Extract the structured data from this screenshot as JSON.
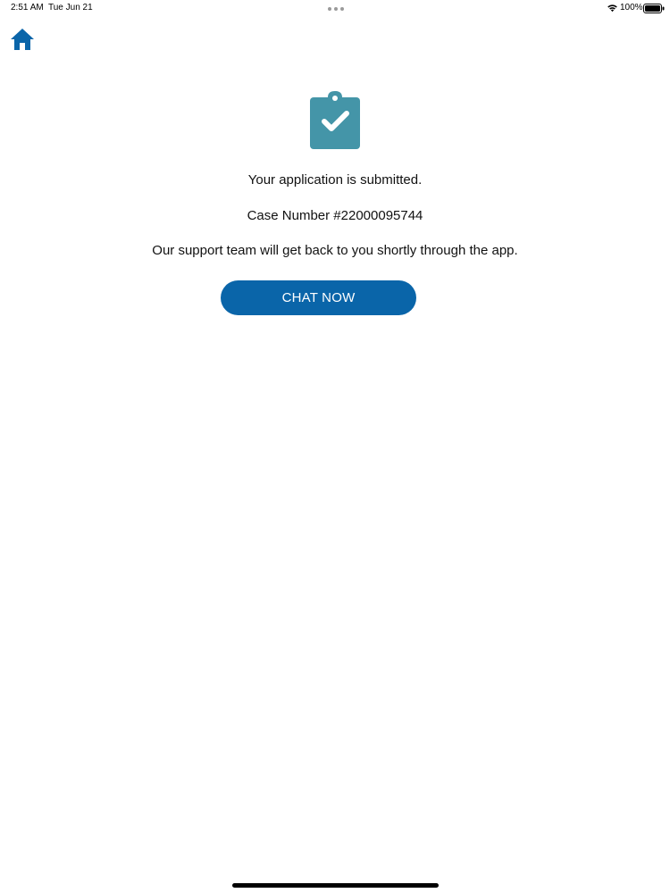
{
  "status_bar": {
    "time": "2:51 AM",
    "date": "Tue Jun 21",
    "battery": "100%",
    "icons": [
      "wifi-icon",
      "battery-icon"
    ]
  },
  "header": {
    "home_icon": "home-icon"
  },
  "confirmation": {
    "icon": "clipboard-check-icon",
    "message": "Your application is submitted.",
    "case_number": "Case Number #22000095744",
    "support_message": "Our support team will get back to you shortly through the app.",
    "chat_button_label": "CHAT NOW"
  },
  "colors": {
    "primary_blue": "#0a65a9",
    "icon_teal": "#4495a8",
    "text": "#111111",
    "background": "#ffffff"
  }
}
